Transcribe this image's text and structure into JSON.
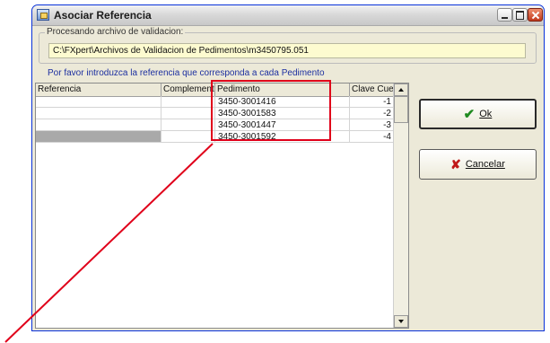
{
  "window": {
    "title": "Asociar Referencia"
  },
  "processing": {
    "legend": "Procesando archivo de validacion:",
    "path": "C:\\FXpert\\Archivos de Validacion de Pedimentos\\m3450795.051"
  },
  "instructions": "Por favor introduzca la referencia que corresponda a cada Pedimento",
  "grid": {
    "columns": [
      "Referencia",
      "Complementaria",
      "Pedimento",
      "Clave Cuenta"
    ],
    "rows": [
      {
        "referencia": "",
        "complementaria": "",
        "pedimento": "3450-3001416",
        "clave": "-1"
      },
      {
        "referencia": "",
        "complementaria": "",
        "pedimento": "3450-3001583",
        "clave": "-2"
      },
      {
        "referencia": "",
        "complementaria": "",
        "pedimento": "3450-3001447",
        "clave": "-3"
      },
      {
        "referencia": "",
        "complementaria": "",
        "pedimento": "3450-3001592",
        "clave": "-4"
      }
    ],
    "selected_row": 3
  },
  "buttons": {
    "ok": {
      "label": "Ok",
      "icon": "check-icon"
    },
    "cancel": {
      "label": "Cancelar",
      "icon": "x-icon"
    }
  },
  "annotation": {
    "highlight_color": "#e0001a"
  }
}
